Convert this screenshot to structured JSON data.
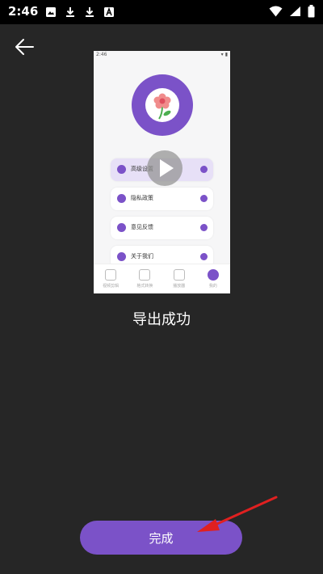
{
  "status_bar": {
    "time": "2:46"
  },
  "preview": {
    "status_time": "2:46",
    "menu": [
      {
        "label": "高级设置"
      },
      {
        "label": "隐私政策"
      },
      {
        "label": "意见反馈"
      },
      {
        "label": "关于我们"
      }
    ],
    "tabs": [
      {
        "label": "视频剪辑"
      },
      {
        "label": "格式转换"
      },
      {
        "label": "播放器"
      },
      {
        "label": "我的"
      }
    ]
  },
  "message": "导出成功",
  "done_label": "完成",
  "colors": {
    "accent": "#7b52c8",
    "background": "#262626",
    "arrow": "#e02020"
  }
}
